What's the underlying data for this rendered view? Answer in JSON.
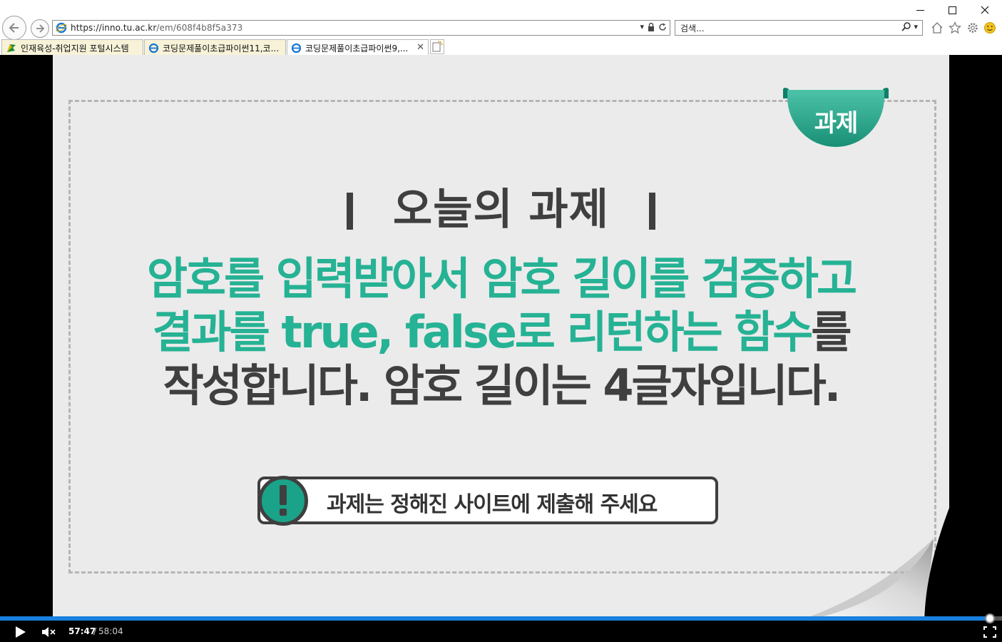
{
  "browser": {
    "address_prefix": "https://",
    "address_host": "inno.tu.ac.kr",
    "address_path": "/em/608f4b8f5a373",
    "search_placeholder": "검색...",
    "tabs": [
      {
        "label": "인재육성-취업지원 포털시스템",
        "active": false
      },
      {
        "label": "코딩문제풀이초급파이썬11,코...",
        "active": false
      },
      {
        "label": "코딩문제풀이초급파이썬9,...",
        "active": true
      }
    ]
  },
  "slide": {
    "badge": "과제",
    "heading": "오늘의 과제",
    "line1": "암호를 입력받아서 암호 길이를 검증하고",
    "line2_main": "결과를 true, false로 리턴하는 함수",
    "line2_tail": "를",
    "line3": "작성합니다.  암호 길이는 4글자입니다.",
    "notice": "과제는 정해진 사이트에 제출해 주세요",
    "notice_mark": "!"
  },
  "player": {
    "current_time": "57:47",
    "separator": "/",
    "total_time": "58:04",
    "progress": 0.99
  },
  "colors": {
    "accent_green": "#26b294",
    "dark_text": "#3f3f3f",
    "progress_blue": "#1a7fde"
  },
  "icons": [
    "back-icon",
    "forward-icon",
    "ie-icon",
    "lock-icon",
    "refresh-icon",
    "search-icon",
    "home-icon",
    "star-icon",
    "gear-icon",
    "smiley-icon",
    "play-icon",
    "mute-icon",
    "fullscreen-icon",
    "close-icon"
  ]
}
